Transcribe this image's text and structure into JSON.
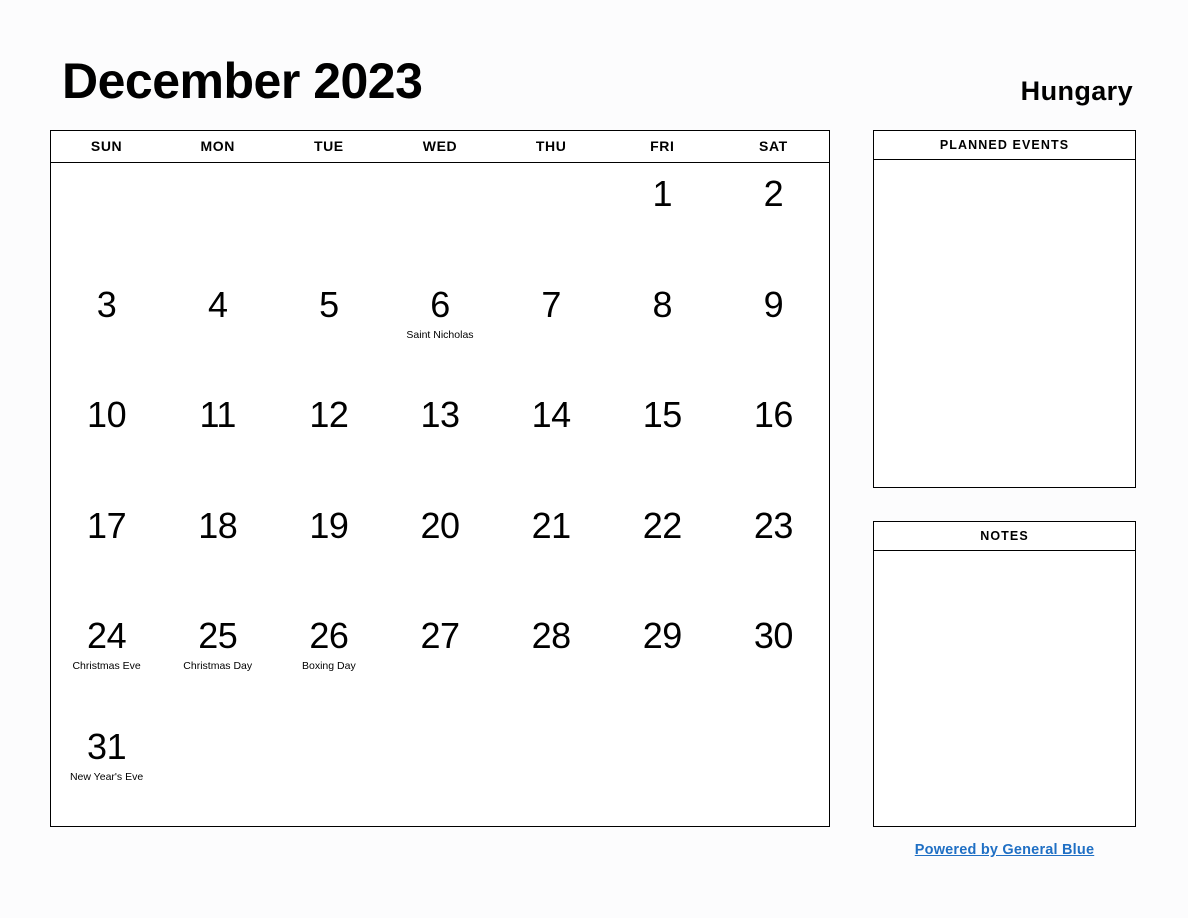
{
  "header": {
    "title": "December 2023",
    "country": "Hungary"
  },
  "calendar": {
    "weekday_headers": [
      "SUN",
      "MON",
      "TUE",
      "WED",
      "THU",
      "FRI",
      "SAT"
    ],
    "weeks": [
      [
        {
          "day": "",
          "holiday": ""
        },
        {
          "day": "",
          "holiday": ""
        },
        {
          "day": "",
          "holiday": ""
        },
        {
          "day": "",
          "holiday": ""
        },
        {
          "day": "",
          "holiday": ""
        },
        {
          "day": "1",
          "holiday": ""
        },
        {
          "day": "2",
          "holiday": ""
        }
      ],
      [
        {
          "day": "3",
          "holiday": ""
        },
        {
          "day": "4",
          "holiday": ""
        },
        {
          "day": "5",
          "holiday": ""
        },
        {
          "day": "6",
          "holiday": "Saint Nicholas"
        },
        {
          "day": "7",
          "holiday": ""
        },
        {
          "day": "8",
          "holiday": ""
        },
        {
          "day": "9",
          "holiday": ""
        }
      ],
      [
        {
          "day": "10",
          "holiday": ""
        },
        {
          "day": "11",
          "holiday": ""
        },
        {
          "day": "12",
          "holiday": ""
        },
        {
          "day": "13",
          "holiday": ""
        },
        {
          "day": "14",
          "holiday": ""
        },
        {
          "day": "15",
          "holiday": ""
        },
        {
          "day": "16",
          "holiday": ""
        }
      ],
      [
        {
          "day": "17",
          "holiday": ""
        },
        {
          "day": "18",
          "holiday": ""
        },
        {
          "day": "19",
          "holiday": ""
        },
        {
          "day": "20",
          "holiday": ""
        },
        {
          "day": "21",
          "holiday": ""
        },
        {
          "day": "22",
          "holiday": ""
        },
        {
          "day": "23",
          "holiday": ""
        }
      ],
      [
        {
          "day": "24",
          "holiday": "Christmas Eve"
        },
        {
          "day": "25",
          "holiday": "Christmas Day"
        },
        {
          "day": "26",
          "holiday": "Boxing Day"
        },
        {
          "day": "27",
          "holiday": ""
        },
        {
          "day": "28",
          "holiday": ""
        },
        {
          "day": "29",
          "holiday": ""
        },
        {
          "day": "30",
          "holiday": ""
        }
      ],
      [
        {
          "day": "31",
          "holiday": "New Year's Eve"
        },
        {
          "day": "",
          "holiday": ""
        },
        {
          "day": "",
          "holiday": ""
        },
        {
          "day": "",
          "holiday": ""
        },
        {
          "day": "",
          "holiday": ""
        },
        {
          "day": "",
          "holiday": ""
        },
        {
          "day": "",
          "holiday": ""
        }
      ]
    ]
  },
  "sidebar": {
    "planned_events": {
      "title": "PLANNED EVENTS",
      "content": ""
    },
    "notes": {
      "title": "NOTES",
      "content": ""
    }
  },
  "footer": {
    "link_text": "Powered by General Blue",
    "link_color": "#1f6fc4"
  }
}
